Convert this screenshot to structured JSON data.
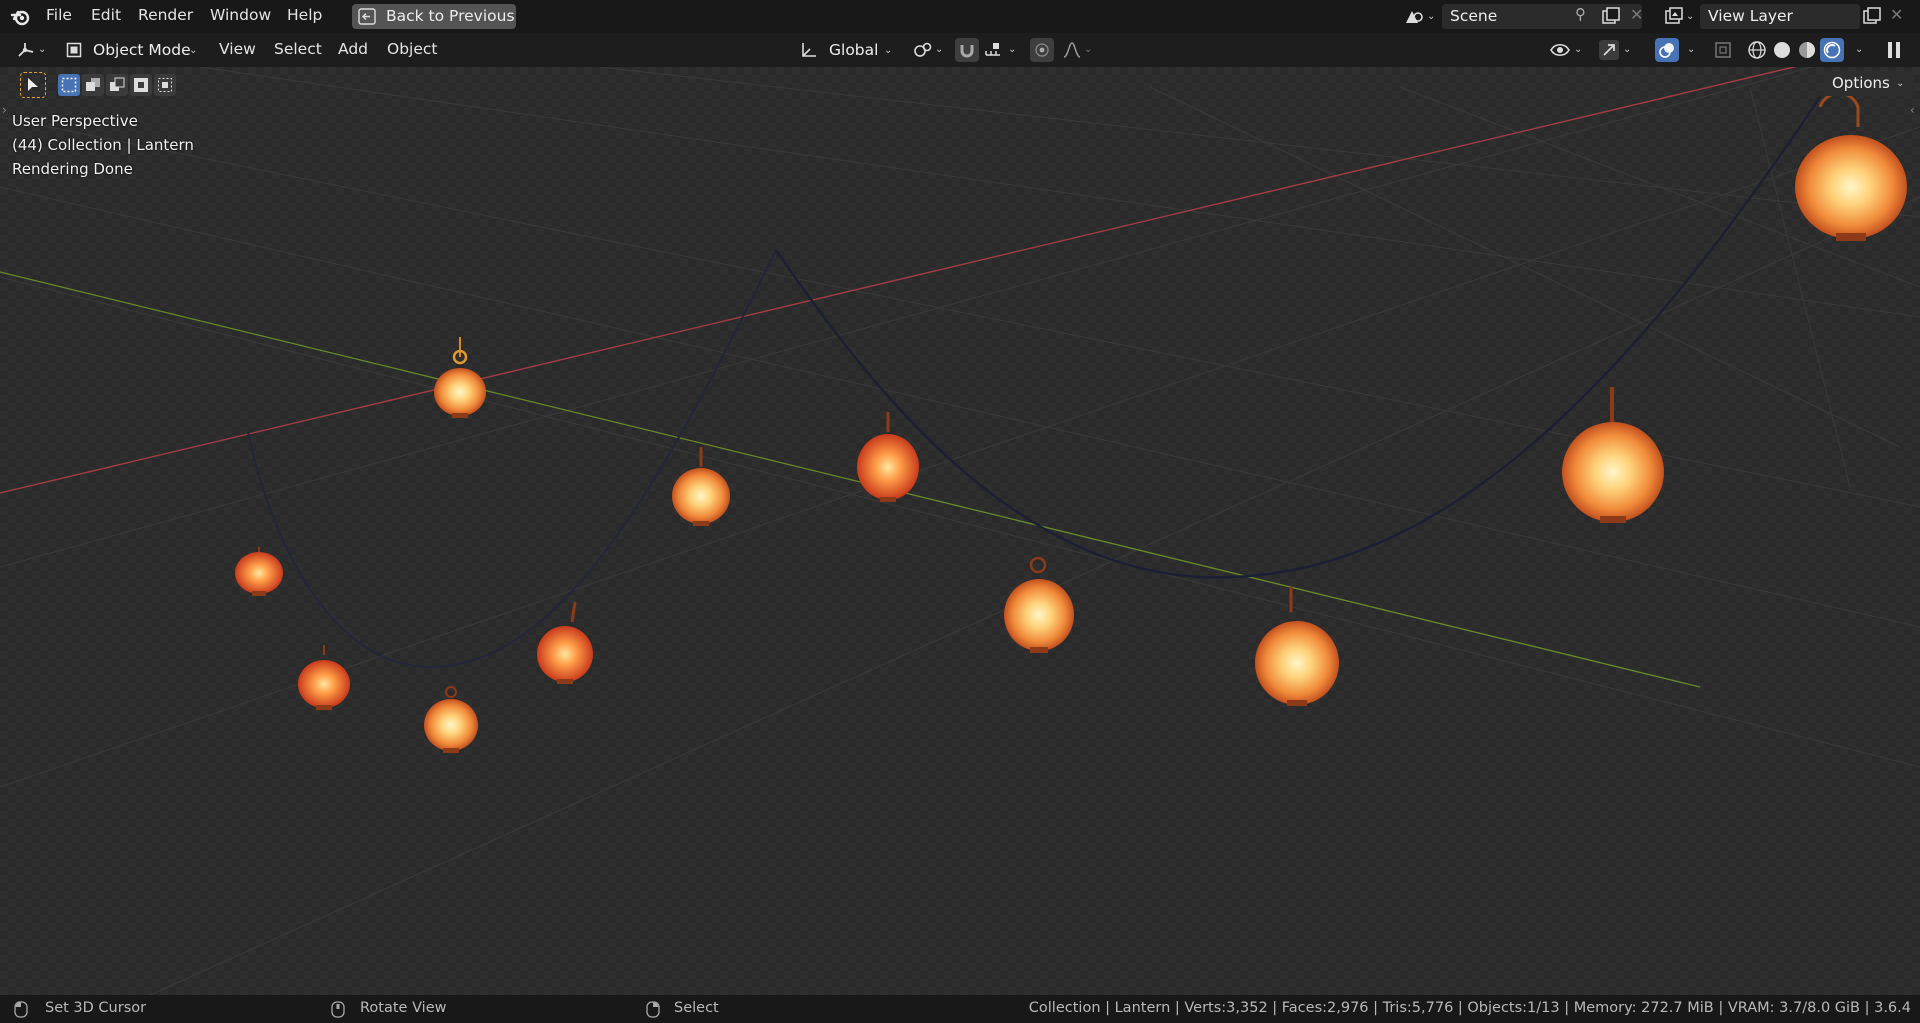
{
  "topbar": {
    "menus": [
      "File",
      "Edit",
      "Render",
      "Window",
      "Help"
    ],
    "back_label": "Back to Previous",
    "scene_value": "Scene",
    "view_layer_value": "View Layer"
  },
  "header": {
    "mode_label": "Object Mode",
    "menus": [
      "View",
      "Select",
      "Add",
      "Object"
    ],
    "orientation_label": "Global",
    "options_label": "Options"
  },
  "viewport": {
    "lines": [
      "User Perspective",
      "(44) Collection | Lantern",
      "Rendering Done"
    ]
  },
  "status": {
    "left_hint": "Set 3D Cursor",
    "mid_hint": "Rotate View",
    "right_hint": "Select",
    "stats": "Collection | Lantern | Verts:3,352 | Faces:2,976 | Tris:5,776 | Objects:1/13 | Memory: 272.7 MiB | VRAM: 3.7/8.0 GiB | 3.6.4"
  },
  "colors": {
    "accent": "#4772b3",
    "x_axis": "#a13c45",
    "y_axis": "#6a8a2a",
    "lantern_glow": "#ffd27a",
    "lantern_red": "#e4572a"
  }
}
